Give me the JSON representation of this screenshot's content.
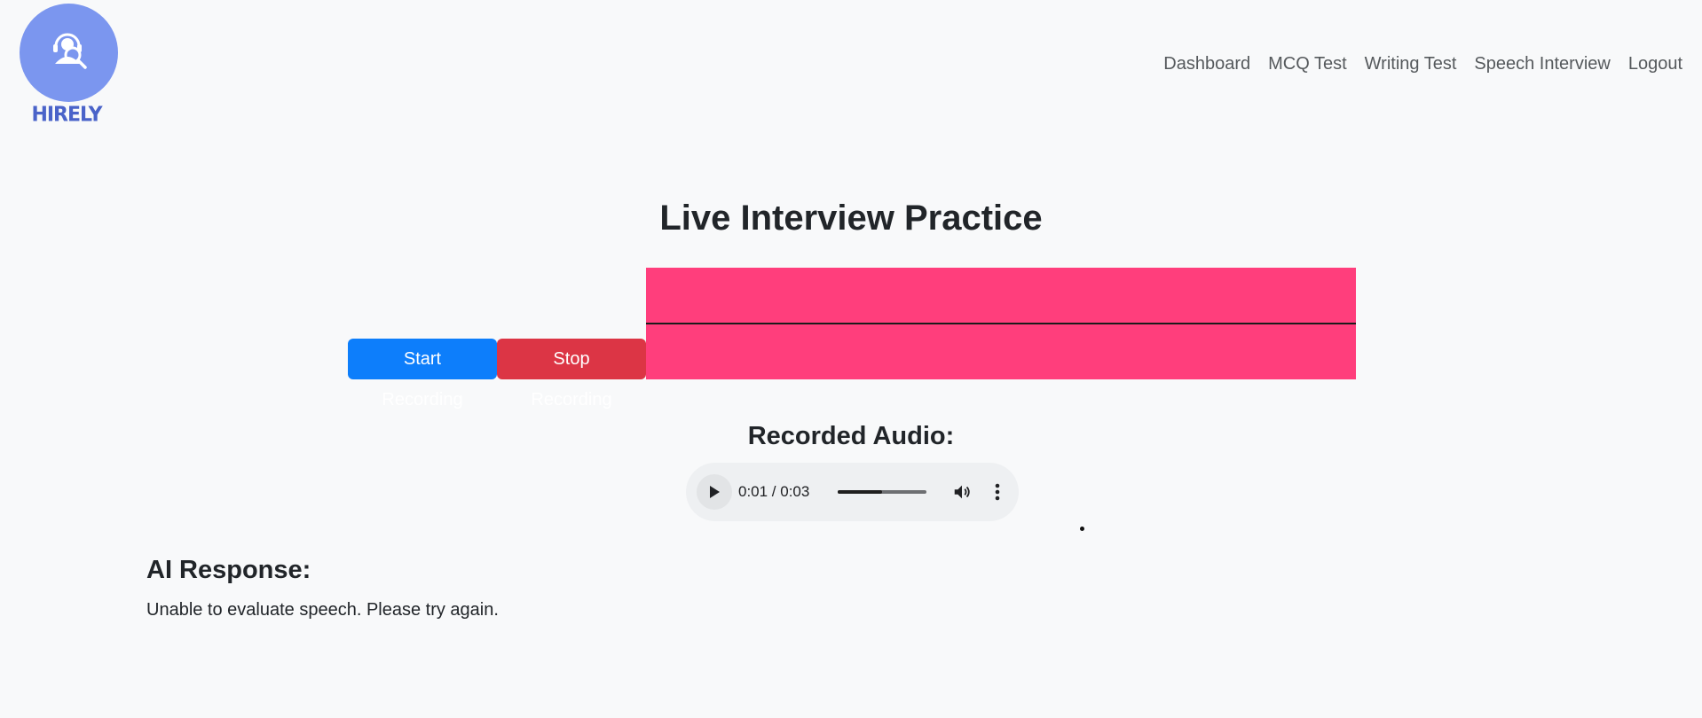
{
  "brand": {
    "name": "HIRELY",
    "logo_color": "#7b96ef",
    "text_color": "#4a63c9"
  },
  "nav": {
    "items": [
      {
        "label": "Dashboard"
      },
      {
        "label": "MCQ Test"
      },
      {
        "label": "Writing Test"
      },
      {
        "label": "Speech Interview"
      },
      {
        "label": "Logout"
      }
    ]
  },
  "main": {
    "title": "Live Interview Practice",
    "start_label": "Start Recording",
    "stop_label": "Stop Recording",
    "visualizer_color": "#ff3e7c",
    "recorded_heading": "Recorded Audio:",
    "audio": {
      "time": "0:01 / 0:03",
      "progress": 0.5,
      "icons": [
        "play-icon",
        "volume-icon",
        "more-vertical-icon"
      ]
    },
    "ai_heading": "AI Response:",
    "ai_text": "Unable to evaluate speech. Please try again."
  },
  "colors": {
    "start_button": "#0d7efb",
    "stop_button": "#dc3545"
  }
}
